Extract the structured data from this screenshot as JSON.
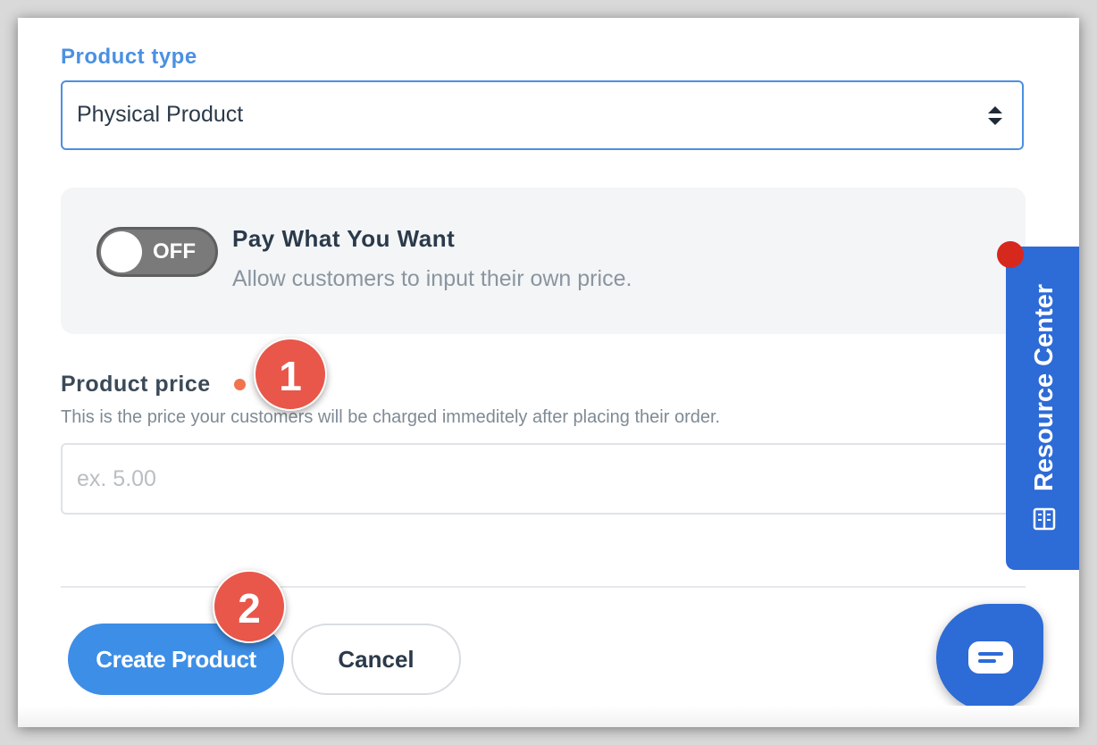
{
  "product_type": {
    "label": "Product type",
    "selected_value": "Physical Product"
  },
  "pay_what_you_want": {
    "toggle_state": "OFF",
    "title": "Pay What You Want",
    "description": "Allow customers to input their own price."
  },
  "product_price": {
    "label": "Product price",
    "help_text": "This is the price your customers will be charged immeditely after placing their order.",
    "placeholder": "ex. 5.00",
    "value": ""
  },
  "actions": {
    "create_label": "Create Product",
    "cancel_label": "Cancel"
  },
  "resource_center": {
    "label": "Resource Center"
  },
  "markers": {
    "step1": "1",
    "step2": "2"
  },
  "colors": {
    "accent": "#4a90e2",
    "primary_button": "#3d8ee6",
    "resource_tab": "#2d6bd6",
    "marker": "#e8574a",
    "required_dot": "#f0744f",
    "notification_badge": "#d7281e"
  },
  "icons": {
    "select_arrows": "sort-arrows-icon",
    "resource": "book-icon",
    "chat": "chat-icon"
  }
}
